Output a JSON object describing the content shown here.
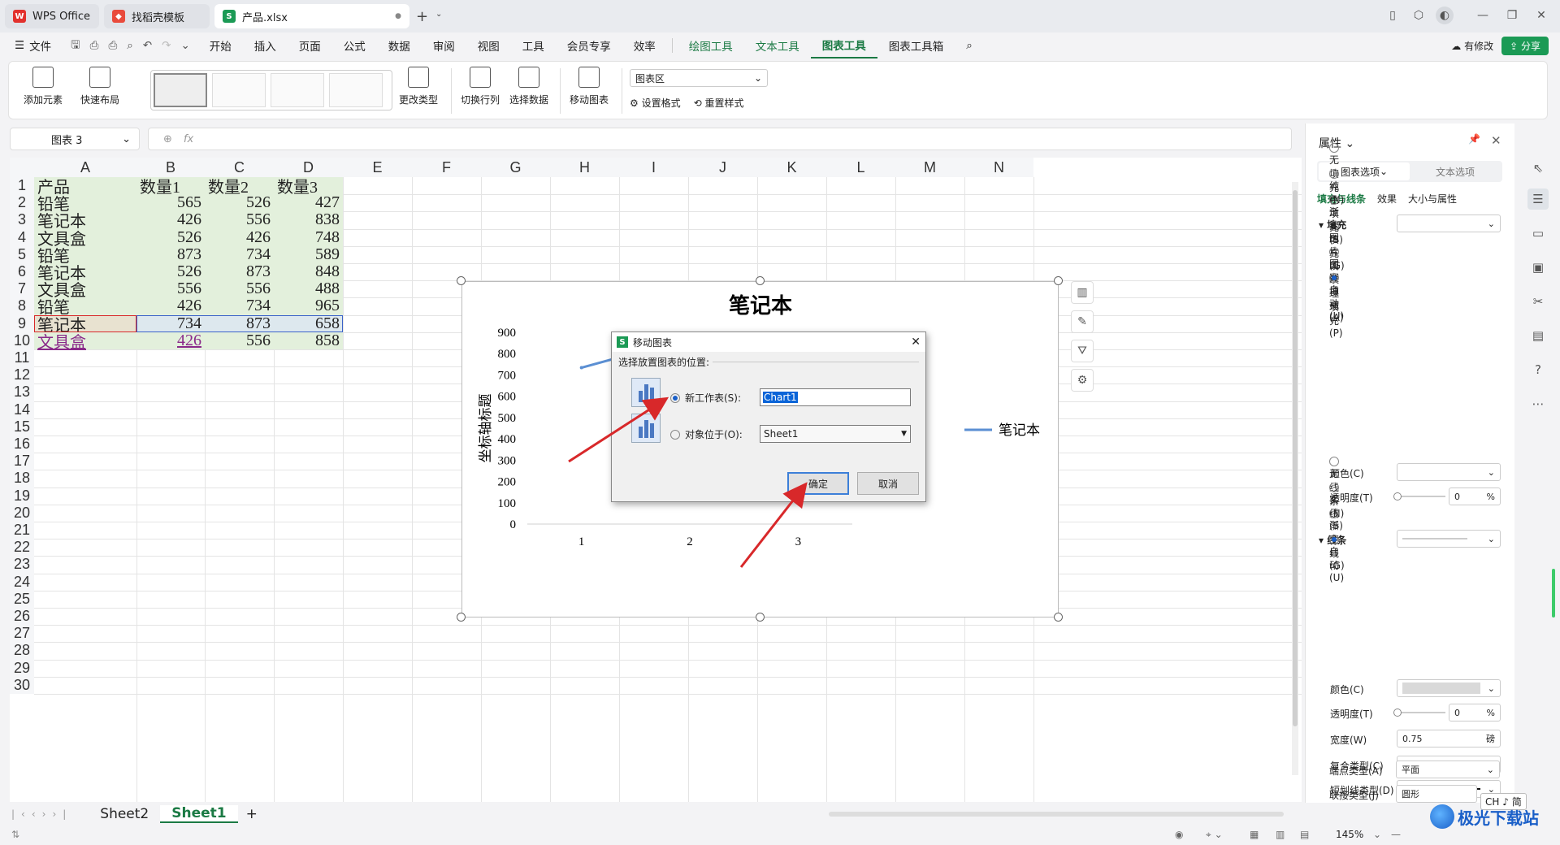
{
  "tabs": [
    {
      "label": "WPS Office",
      "icon": "wps-logo-icon"
    },
    {
      "label": "找稻壳模板",
      "icon": "docer-icon"
    },
    {
      "label": "产品.xlsx",
      "icon": "spreadsheet-icon"
    }
  ],
  "menu": {
    "file": "文件",
    "items": [
      "开始",
      "插入",
      "页面",
      "公式",
      "数据",
      "审阅",
      "视图",
      "工具",
      "会员专享",
      "效率"
    ],
    "context_items": [
      "绘图工具",
      "文本工具",
      "图表工具",
      "图表工具箱"
    ],
    "active": "图表工具",
    "has_changes": "有修改",
    "share": "分享"
  },
  "ribbon": {
    "add_element": "添加元素",
    "quick_layout": "快速布局",
    "change_type": "更改类型",
    "switch_row_col": "切换行列",
    "select_data": "选择数据",
    "move_chart": "移动图表",
    "chart_area": "图表区",
    "format": "设置格式",
    "reset_style": "重置样式"
  },
  "formula": {
    "namebox": "图表 3",
    "fx": "fx"
  },
  "columns": [
    "A",
    "B",
    "C",
    "D",
    "E",
    "F",
    "G",
    "H",
    "I",
    "J",
    "K",
    "L",
    "M",
    "N"
  ],
  "rows": [
    "1",
    "2",
    "3",
    "4",
    "5",
    "6",
    "7",
    "8",
    "9",
    "10",
    "11",
    "12",
    "13",
    "14",
    "15",
    "16",
    "17",
    "18",
    "19",
    "20",
    "21",
    "22",
    "23",
    "24",
    "25",
    "26",
    "27",
    "28",
    "29",
    "30"
  ],
  "table": {
    "header": [
      "产品",
      "数量1",
      "数量2",
      "数量3"
    ],
    "data": [
      [
        "铅笔",
        "565",
        "526",
        "427"
      ],
      [
        "笔记本",
        "426",
        "556",
        "838"
      ],
      [
        "文具盒",
        "526",
        "426",
        "748"
      ],
      [
        "铅笔",
        "873",
        "734",
        "589"
      ],
      [
        "笔记本",
        "526",
        "873",
        "848"
      ],
      [
        "文具盒",
        "556",
        "556",
        "488"
      ],
      [
        "铅笔",
        "426",
        "734",
        "965"
      ],
      [
        "笔记本",
        "734",
        "873",
        "658"
      ],
      [
        "文具盒",
        "426",
        "556",
        "858"
      ]
    ]
  },
  "chart_data": {
    "type": "line",
    "title": "笔记本",
    "ylabel": "坐标轴标题",
    "xlabel": "",
    "categories": [
      "1",
      "2",
      "3"
    ],
    "y_ticks": [
      "900",
      "800",
      "700",
      "600",
      "500",
      "400",
      "300",
      "200",
      "100",
      "0"
    ],
    "ylim": [
      0,
      900
    ],
    "legend_position": "right",
    "series": [
      {
        "name": "笔记本",
        "values": [
          734,
          873,
          658
        ],
        "color": "#5b8fd3"
      }
    ]
  },
  "dialog": {
    "title": "移动图表",
    "prompt": "选择放置图表的位置:",
    "new_sheet_label": "新工作表(S):",
    "new_sheet_value": "Chart1",
    "object_in_label": "对象位于(O):",
    "object_in_value": "Sheet1",
    "ok": "确定",
    "cancel": "取消"
  },
  "panel": {
    "title": "属性",
    "tab_chart": "图表选项",
    "tab_text": "文本选项",
    "subtabs": [
      "填充与线条",
      "效果",
      "大小与属性"
    ],
    "fill_section": "填充",
    "fill_options": [
      "无填充(N)",
      "纯色填充(S)",
      "渐变填充(G)",
      "图片或纹理填充(P)",
      "图案填充(A)",
      "自动(U)"
    ],
    "color_label": "颜色(C)",
    "transparency_label": "透明度(T)",
    "transparency_value": "0",
    "percent": "%",
    "line_section": "线条",
    "line_options": [
      "无线条(N)",
      "实线(S)",
      "渐变线(G)",
      "自动(U)"
    ],
    "line_color_label": "颜色(C)",
    "line_transparency_label": "透明度(T)",
    "line_transparency_value": "0",
    "width_label": "宽度(W)",
    "width_value": "0.75",
    "width_unit": "磅",
    "compound_label": "复合类型(C)",
    "dash_label": "短划线类型(D)",
    "cap_label": "端点类型(A)",
    "cap_value": "平面",
    "join_label": "联接类型(J)",
    "join_value": "圆形"
  },
  "sheets": {
    "tabs": [
      "Sheet2",
      "Sheet1"
    ],
    "active": "Sheet1",
    "add": "+"
  },
  "status": {
    "zoom": "145%",
    "ime": "CH ♪ 简"
  },
  "watermark": "极光下载站"
}
